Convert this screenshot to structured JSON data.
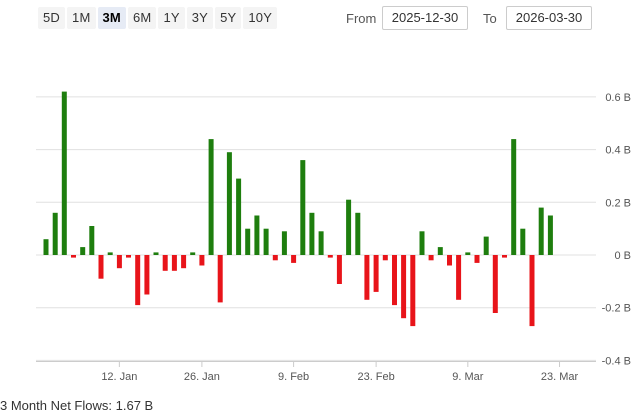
{
  "range_buttons": [
    "5D",
    "1M",
    "3M",
    "6M",
    "1Y",
    "3Y",
    "5Y",
    "10Y"
  ],
  "active_range": "3M",
  "date_range": {
    "from_label": "From",
    "from_value": "2025-12-30",
    "to_label": "To",
    "to_value": "2026-03-30"
  },
  "footer": {
    "label": "3 Month Net Flows:",
    "value": "1.67 B"
  },
  "colors": {
    "positive": "#1e7e0e",
    "negative": "#e8141a",
    "grid": "#e0e0e0"
  },
  "chart_data": {
    "type": "bar",
    "title": "",
    "xlabel": "",
    "ylabel": "",
    "ylim": [
      -0.4,
      0.6
    ],
    "y_ticks": [
      0.6,
      0.4,
      0.2,
      0,
      -0.2,
      -0.4
    ],
    "y_tick_labels": [
      "0.6 B",
      "0.4 B",
      "0.2 B",
      "0 B",
      "-0.2 B",
      "-0.4 B"
    ],
    "x_tick_labels": [
      {
        "date": "2026-01-12",
        "label": "12. Jan"
      },
      {
        "date": "2026-01-26",
        "label": "26. Jan"
      },
      {
        "date": "2026-02-09",
        "label": "9. Feb"
      },
      {
        "date": "2026-02-23",
        "label": "23. Feb"
      },
      {
        "date": "2026-03-09",
        "label": "9. Mar"
      },
      {
        "date": "2026-03-23",
        "label": "23. Mar"
      }
    ],
    "grid": true,
    "legend": "none",
    "x": [
      "2025-12-30",
      "2025-12-31",
      "2026-01-02",
      "2026-01-05",
      "2026-01-06",
      "2026-01-07",
      "2026-01-08",
      "2026-01-09",
      "2026-01-12",
      "2026-01-13",
      "2026-01-14",
      "2026-01-15",
      "2026-01-16",
      "2026-01-20",
      "2026-01-21",
      "2026-01-22",
      "2026-01-23",
      "2026-01-26",
      "2026-01-27",
      "2026-01-28",
      "2026-01-29",
      "2026-01-30",
      "2026-02-02",
      "2026-02-03",
      "2026-02-04",
      "2026-02-05",
      "2026-02-06",
      "2026-02-09",
      "2026-02-10",
      "2026-02-11",
      "2026-02-12",
      "2026-02-13",
      "2026-02-17",
      "2026-02-18",
      "2026-02-19",
      "2026-02-20",
      "2026-02-23",
      "2026-02-24",
      "2026-02-25",
      "2026-02-26",
      "2026-02-27",
      "2026-03-02",
      "2026-03-03",
      "2026-03-04",
      "2026-03-05",
      "2026-03-06",
      "2026-03-09",
      "2026-03-10",
      "2026-03-11",
      "2026-03-12",
      "2026-03-13",
      "2026-03-16",
      "2026-03-17",
      "2026-03-18",
      "2026-03-19",
      "2026-03-20",
      "2026-03-23",
      "2026-03-24",
      "2026-03-25",
      "2026-03-26",
      "2026-03-27",
      "2026-03-30"
    ],
    "values": [
      0.06,
      0.16,
      0.62,
      -0.01,
      0.03,
      0.11,
      -0.09,
      0.01,
      -0.05,
      -0.01,
      -0.19,
      -0.15,
      0.01,
      -0.06,
      -0.06,
      -0.05,
      0.01,
      -0.04,
      0.44,
      -0.18,
      0.39,
      0.29,
      0.1,
      0.15,
      0.1,
      -0.02,
      0.09,
      -0.03,
      0.36,
      0.16,
      0.09,
      -0.01,
      -0.11,
      0.21,
      0.16,
      -0.17,
      -0.14,
      -0.02,
      -0.19,
      -0.24,
      -0.27,
      0.09,
      -0.02,
      0.03,
      -0.04,
      -0.17,
      0.01,
      -0.03,
      0.07,
      -0.22,
      -0.01,
      0.44,
      0.1,
      -0.27,
      0.18,
      0.15,
      0,
      0,
      0,
      0,
      0,
      0
    ],
    "values_note": ""
  }
}
